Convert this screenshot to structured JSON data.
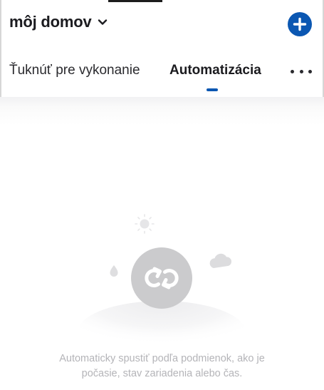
{
  "header": {
    "home_title": "môj domov",
    "add_icon": "plus-circle-icon",
    "accent_color": "#0b57b2"
  },
  "tabs": {
    "items": [
      {
        "label": "Ťuknúť pre vykonanie",
        "selected": false
      },
      {
        "label": "Automatizácia",
        "selected": true
      }
    ],
    "more_icon": "more-horizontal-icon"
  },
  "empty_state": {
    "illustration_icon": "automation-sync-icon",
    "line1": "Automaticky spustiť podľa podmienok, ako je",
    "line2": "počasie, stav zariadenia alebo čas."
  }
}
